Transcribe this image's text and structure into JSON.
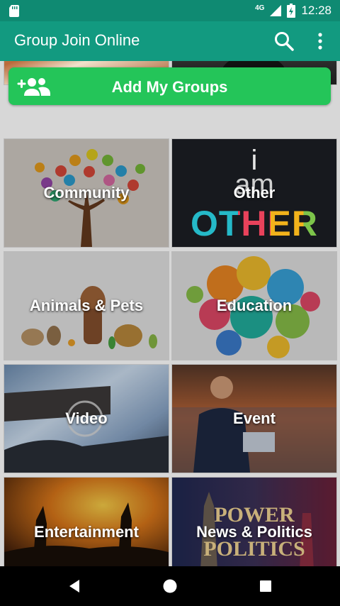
{
  "status_bar": {
    "network": "4G",
    "time": "12:28"
  },
  "app_bar": {
    "title": "Group Join Online"
  },
  "add_groups": {
    "label": "Add My Groups"
  },
  "categories": [
    {
      "label": "Community"
    },
    {
      "label": "Other"
    },
    {
      "label": "Animals & Pets"
    },
    {
      "label": "Education"
    },
    {
      "label": "Video"
    },
    {
      "label": "Event"
    },
    {
      "label": "Entertainment"
    },
    {
      "label": "News & Politics"
    }
  ],
  "other_tile_art_text": {
    "line1": "i",
    "line2": "am",
    "line3": "OTHER"
  },
  "news_tile_art_text": {
    "line1": "POWER",
    "line2": "POLITICS"
  },
  "colors": {
    "status_bar": "#0f8a72",
    "app_bar": "#129a80",
    "add_button": "#24c559"
  }
}
